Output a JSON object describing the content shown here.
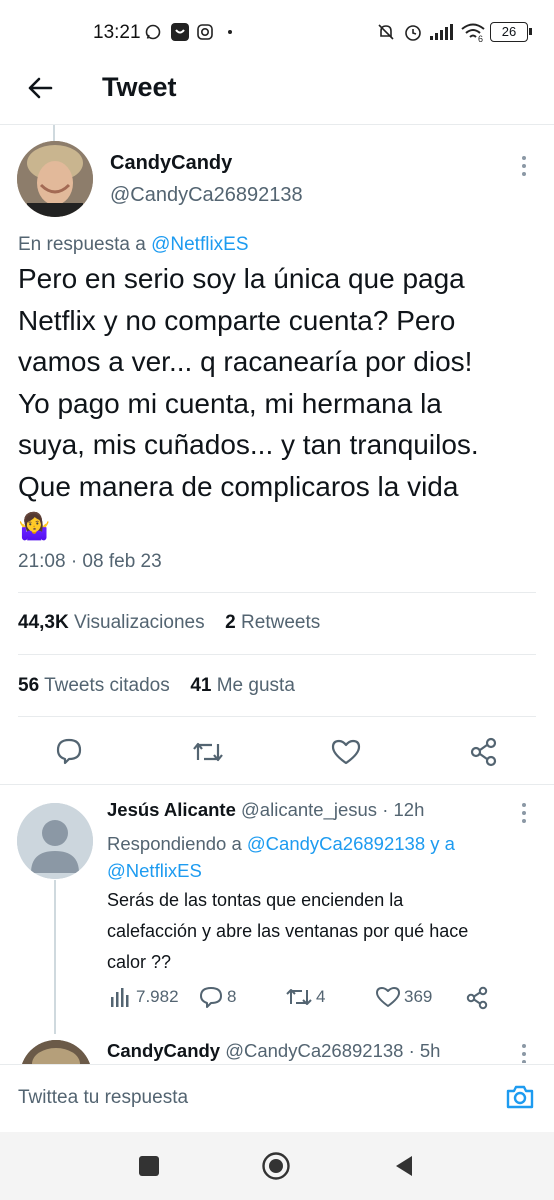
{
  "status_bar": {
    "time": "13:21",
    "battery": "26",
    "network_label": "6"
  },
  "header": {
    "title": "Tweet"
  },
  "tweet": {
    "author_name": "CandyCandy",
    "author_handle": "@CandyCa26892138",
    "reply_prefix": "En respuesta a",
    "reply_to": "@NetflixES",
    "lines": [
      "Pero en serio soy la única que paga",
      "Netflix y no comparte cuenta? Pero",
      "vamos a ver... q racanearía por dios!",
      "Yo pago mi cuenta, mi hermana la",
      "suya, mis cuñados... y tan tranquilos.",
      "Que manera de complicaros la vida"
    ],
    "emoji": "🤷‍♀️",
    "timestamp": "21:08 · 08 feb 23",
    "views_count": "44,3K",
    "views_label": "Visualizaciones",
    "retweets_count": "2",
    "retweets_label": "Retweets",
    "quotes_count": "56",
    "quotes_label": "Tweets citados",
    "likes_count": "41",
    "likes_label": "Me gusta"
  },
  "reply": {
    "author_name": "Jesús Alicante",
    "author_handle": "@alicante_jesus",
    "age": "· 12h",
    "replying_prefix": "Respondiendo a",
    "replying_to_1": "@CandyCa26892138 y a",
    "replying_to_2": "@NetflixES",
    "lines": [
      "Serás de las tontas que encienden la",
      "calefacción y abre las ventanas por qué hace",
      "calor ??"
    ],
    "views": "7.982",
    "replies": "8",
    "retweets": "4",
    "likes": "369"
  },
  "next_reply": {
    "author_name": "CandyCandy",
    "author_handle": "@CandyCa26892138",
    "age": "· 5h"
  },
  "composer": {
    "placeholder": "Twittea tu respuesta"
  },
  "colors": {
    "accent": "#1d9bf0",
    "muted": "#536471",
    "text": "#0f1419"
  }
}
